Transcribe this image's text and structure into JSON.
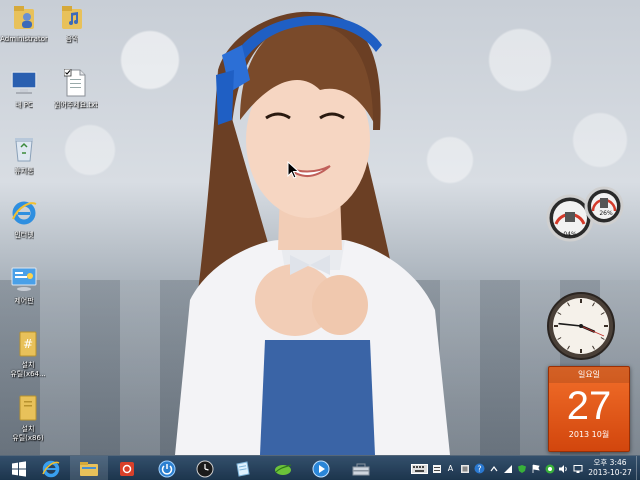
{
  "desktop": {
    "icons": [
      {
        "name": "administrator-folder-icon",
        "label": "Administrator"
      },
      {
        "name": "music-folder-icon",
        "label": "음악"
      },
      {
        "name": "my-pc-icon",
        "label": "내 PC"
      },
      {
        "name": "text-file-icon",
        "label": "읽어주세요.txt"
      },
      {
        "name": "recycle-bin-icon",
        "label": "휴지통"
      },
      {
        "name": "internet-explorer-icon",
        "label": "인터넷"
      },
      {
        "name": "control-panel-icon",
        "label": "제어판"
      },
      {
        "name": "setup-x64-folder-icon",
        "label": "설치\n유틸(x64..."
      },
      {
        "name": "setup-x86-folder-icon",
        "label": "설치\n유틸(x86)"
      }
    ]
  },
  "gadgets": {
    "cpu_meter": {
      "cpu_percent": "04%",
      "mem_percent": "26%"
    },
    "calendar": {
      "weekday": "일요일",
      "day": "27",
      "year_month": "2013 10월"
    },
    "analog_clock": {
      "hour": 3,
      "minute": 46
    }
  },
  "taskbar": {
    "buttons": [
      {
        "name": "start-button-windows-icon"
      },
      {
        "name": "taskbar-ie-icon"
      },
      {
        "name": "taskbar-file-explorer-icon"
      },
      {
        "name": "taskbar-red-app-icon"
      },
      {
        "name": "taskbar-power-icon"
      },
      {
        "name": "taskbar-clock-app-icon"
      },
      {
        "name": "taskbar-notepad-icon"
      },
      {
        "name": "taskbar-green-app-icon"
      },
      {
        "name": "taskbar-media-player-icon"
      },
      {
        "name": "taskbar-toolbox-icon"
      }
    ],
    "tray": {
      "ime_mode": "A",
      "help": "?",
      "time": "오후 3:46",
      "date": "2013-10-27"
    }
  },
  "colors": {
    "taskbar": "#1f3f5c",
    "calendar": "#e85a1a",
    "headband": "#1f5fc4"
  }
}
